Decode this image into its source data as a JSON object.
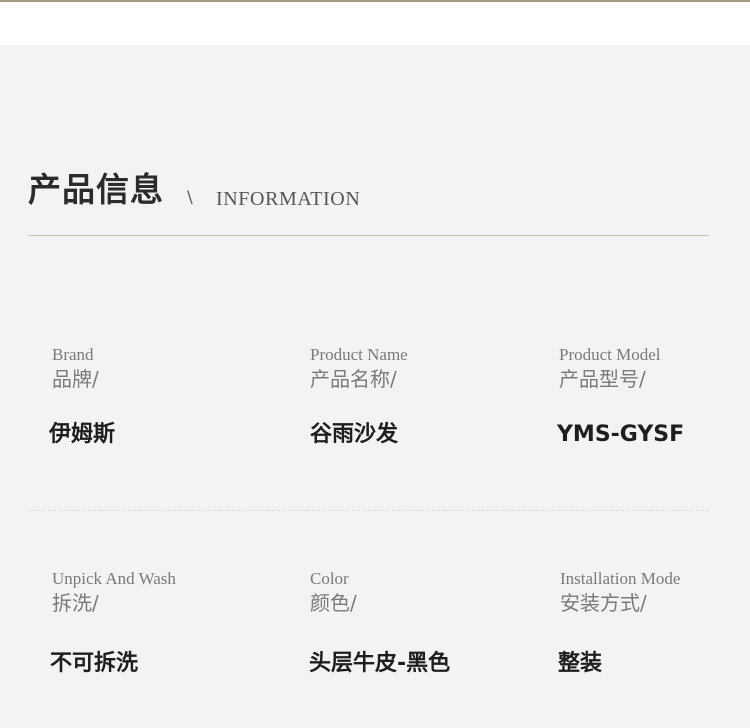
{
  "header": {
    "title_zh": "产品信息",
    "separator": "\\",
    "title_en": "INFORMATION"
  },
  "attributes": [
    {
      "label_en": "Brand",
      "label_zh": "品牌/",
      "value": "伊姆斯"
    },
    {
      "label_en": "Product Name",
      "label_zh": "产品名称/",
      "value": "谷雨沙发"
    },
    {
      "label_en": "Product Model",
      "label_zh": "产品型号/",
      "value": "YMS-GYSF"
    },
    {
      "label_en": "Unpick And Wash",
      "label_zh": "拆洗/",
      "value": "不可拆洗"
    },
    {
      "label_en": "Color",
      "label_zh": "颜色/",
      "value": "头层牛皮-黑色"
    },
    {
      "label_en": "Installation Mode",
      "label_zh": "安装方式/",
      "value": "整装"
    }
  ],
  "colors": {
    "top_rule": "#a89a86",
    "panel_background": "#f4f3f1",
    "heading_text": "#2b2b2b",
    "label_text": "#7a7a7a",
    "value_text": "#1e1e1e",
    "divider": "#c4c0ba"
  }
}
